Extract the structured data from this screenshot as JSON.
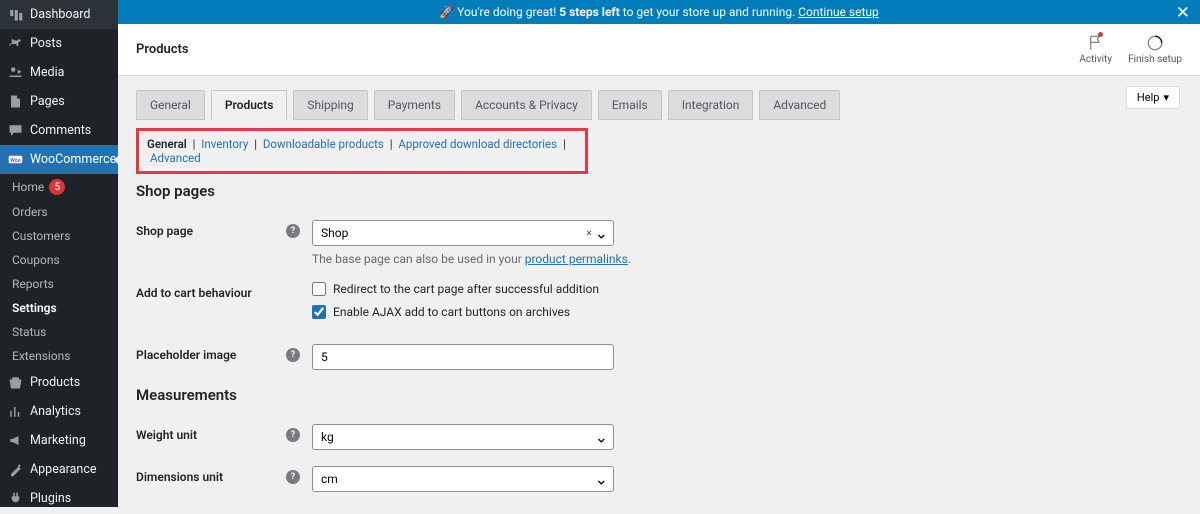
{
  "banner": {
    "emoji": "🚀",
    "text_before": " You're doing great! ",
    "bold": "5 steps left",
    "text_after": " to get your store up and running. ",
    "link": "Continue setup"
  },
  "sidebar": {
    "items": [
      {
        "icon": "dashboard",
        "label": "Dashboard"
      },
      {
        "icon": "pin",
        "label": "Posts"
      },
      {
        "icon": "media",
        "label": "Media"
      },
      {
        "icon": "page",
        "label": "Pages"
      },
      {
        "icon": "comment",
        "label": "Comments"
      },
      {
        "icon": "woo",
        "label": "WooCommerce",
        "active": true
      },
      {
        "icon": "product",
        "label": "Products"
      },
      {
        "icon": "analytics",
        "label": "Analytics"
      },
      {
        "icon": "marketing",
        "label": "Marketing"
      },
      {
        "icon": "appearance",
        "label": "Appearance"
      },
      {
        "icon": "plugin",
        "label": "Plugins"
      }
    ],
    "sub": [
      {
        "label": "Home",
        "badge": "5"
      },
      {
        "label": "Orders"
      },
      {
        "label": "Customers"
      },
      {
        "label": "Coupons"
      },
      {
        "label": "Reports"
      },
      {
        "label": "Settings",
        "current": true
      },
      {
        "label": "Status"
      },
      {
        "label": "Extensions"
      }
    ]
  },
  "topbar": {
    "title": "Products",
    "activity": "Activity",
    "finish": "Finish setup",
    "help": "Help"
  },
  "tabs": [
    "General",
    "Products",
    "Shipping",
    "Payments",
    "Accounts & Privacy",
    "Emails",
    "Integration",
    "Advanced"
  ],
  "active_tab": 1,
  "subsub": {
    "items": [
      "General",
      "Inventory",
      "Downloadable products",
      "Approved download directories",
      "Advanced"
    ],
    "current": 0
  },
  "sections": {
    "shop_pages_title": "Shop pages",
    "measurements_title": "Measurements"
  },
  "fields": {
    "shop_page": {
      "label": "Shop page",
      "value": "Shop",
      "desc_before": "The base page can also be used in your ",
      "desc_link": "product permalinks",
      "desc_after": "."
    },
    "add_to_cart": {
      "label": "Add to cart behaviour",
      "cb1": "Redirect to the cart page after successful addition",
      "cb1_checked": false,
      "cb2": "Enable AJAX add to cart buttons on archives",
      "cb2_checked": true
    },
    "placeholder": {
      "label": "Placeholder image",
      "value": "5"
    },
    "weight": {
      "label": "Weight unit",
      "value": "kg"
    },
    "dimensions": {
      "label": "Dimensions unit",
      "value": "cm"
    }
  }
}
